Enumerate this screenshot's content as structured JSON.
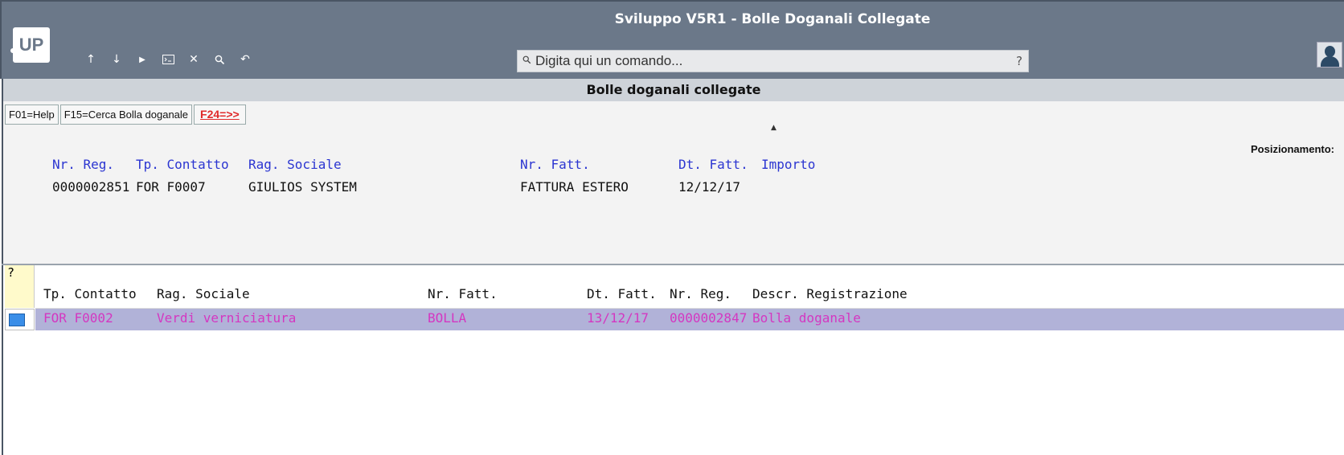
{
  "window": {
    "title": "Sviluppo V5R1 - Bolle Doganali Collegate"
  },
  "logo": {
    "text": "UP"
  },
  "toolbar": {
    "icons": [
      "arrow-up-icon",
      "arrow-down-icon",
      "play-icon",
      "terminal-icon",
      "close-icon",
      "search-icon",
      "undo-icon"
    ]
  },
  "command": {
    "placeholder": "Digita qui un comando...",
    "help": "?"
  },
  "panel": {
    "title": "Bolle doganali collegate",
    "fkeys": [
      "F01=Help",
      "F15=Cerca Bolla doganale",
      "F24=>>"
    ],
    "positioning_label": "Posizionamento:",
    "headers": {
      "nr_reg": "Nr. Reg.",
      "tp_contatto": "Tp. Contatto",
      "rag_sociale": "Rag. Sociale",
      "nr_fatt": "Nr. Fatt.",
      "dt_fatt": "Dt. Fatt.",
      "importo": "Importo"
    },
    "values": {
      "nr_reg": "0000002851",
      "tp_contatto": "FOR F0007",
      "rag_sociale": "GIULIOS SYSTEM",
      "nr_fatt": "FATTURA ESTERO",
      "dt_fatt": "12/12/17",
      "importo": ""
    }
  },
  "grid": {
    "question": "?",
    "columns": {
      "tp_contatto": "Tp. Contatto",
      "rag_sociale": "Rag. Sociale",
      "nr_fatt": "Nr. Fatt.",
      "dt_fatt": "Dt. Fatt.",
      "nr_reg": "Nr. Reg.",
      "descr": "Descr. Registrazione"
    },
    "rows": [
      {
        "tp_contatto": "FOR F0002",
        "rag_sociale": "Verdi verniciatura",
        "nr_fatt": "BOLLA",
        "dt_fatt": "13/12/17",
        "nr_reg": "0000002847",
        "descr": "Bolla doganale"
      }
    ]
  },
  "colors": {
    "header_blue": "#2b35d1",
    "row_text": "#d437c1",
    "row_bg": "#b1b2d8",
    "topbar": "#6b7889"
  }
}
